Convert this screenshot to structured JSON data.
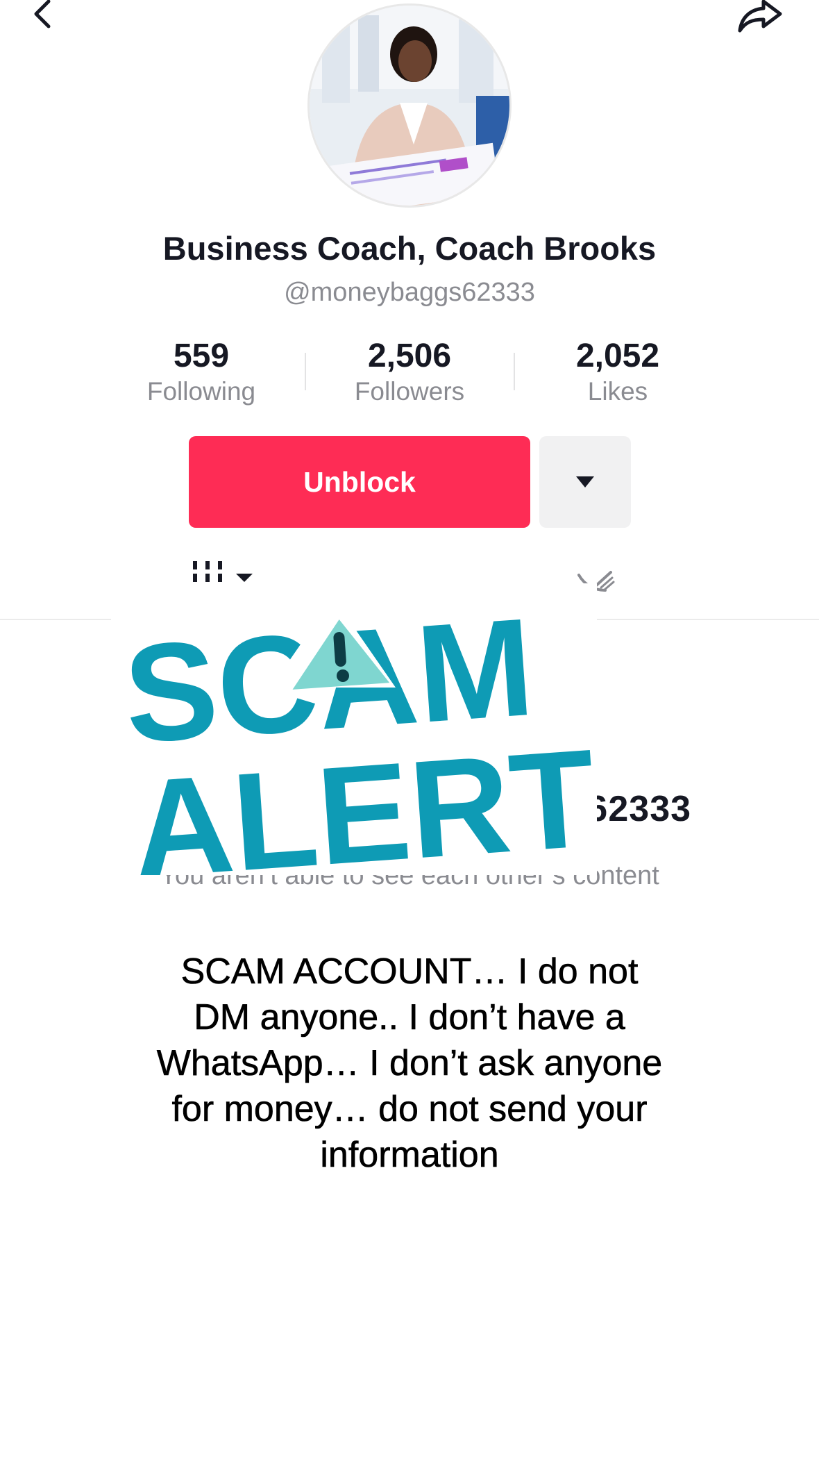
{
  "header": {
    "back_icon": "chevron-left-icon",
    "share_icon": "share-icon"
  },
  "profile": {
    "name": "Business Coach, Coach Brooks",
    "handle": "@moneybaggs62333",
    "stats": [
      {
        "value": "559",
        "label": "Following"
      },
      {
        "value": "2,506",
        "label": "Followers"
      },
      {
        "value": "2,052",
        "label": "Likes"
      }
    ]
  },
  "actions": {
    "unblock_label": "Unblock",
    "more_icon": "caret-down-icon"
  },
  "tabs": {
    "videos_icon": "grid-icon",
    "liked_icon": "heart-hidden-icon"
  },
  "blocked": {
    "title": "You blocked moneybaggs62333",
    "subtitle": "You aren’t able to see each other’s content"
  },
  "overlay": {
    "line1": "SCAM",
    "line2": "ALERT",
    "color": "#0e9bb5",
    "triangle_color": "#7fd6d0"
  },
  "notice_text": "SCAM ACCOUNT… I do not DM anyone.. I don’t have a WhatsApp… I don’t ask anyone for money… do not send your information",
  "colors": {
    "accent": "#fe2c55",
    "muted": "#8a8b91",
    "text": "#161823"
  }
}
